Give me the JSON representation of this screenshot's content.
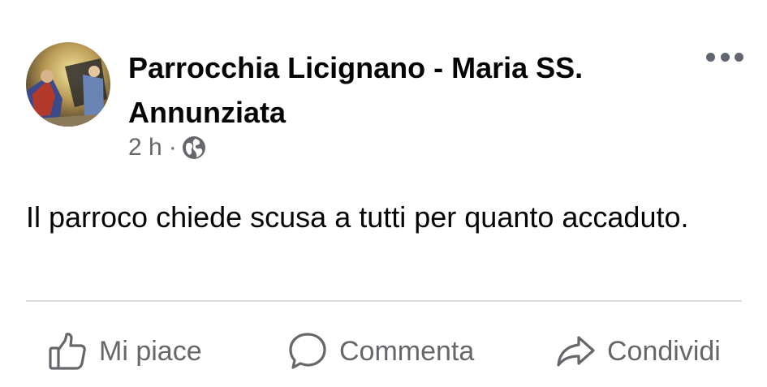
{
  "post": {
    "author": "Parrocchia Licignano - Maria SS. Annunziata",
    "time": "2 h",
    "separator": "·",
    "privacy_icon": "globe-icon",
    "more_icon": "more-options-icon",
    "text": "Il parroco chiede scusa a tutti per quanto accaduto."
  },
  "actions": {
    "like_label": "Mi piace",
    "comment_label": "Commenta",
    "share_label": "Condividi"
  },
  "colors": {
    "text": "#050505",
    "secondary": "#65676b",
    "divider": "#dadde1"
  }
}
